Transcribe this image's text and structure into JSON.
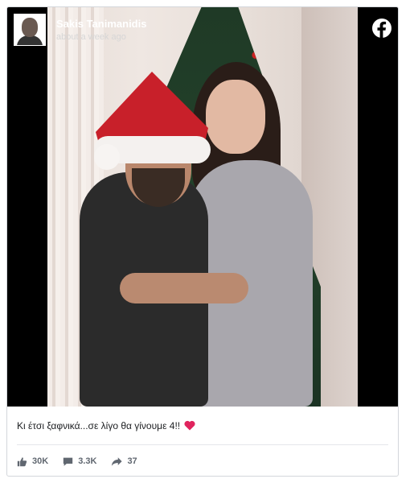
{
  "post": {
    "author": "Sakis Tanimanidis",
    "timestamp": "about a week ago",
    "caption": "Κι έτσι ξαφνικά...σε λίγο θα γίνουμε 4!!",
    "caption_emoji": "heart-icon"
  },
  "stats": {
    "likes": "30K",
    "comments": "3.3K",
    "shares": "37"
  },
  "icons": {
    "brand": "facebook-icon",
    "like": "thumbs-up-icon",
    "comment": "comment-icon",
    "share": "share-arrow-icon"
  },
  "colors": {
    "facebook": "#ffffff",
    "heart": "#e0245e",
    "text": "#1c1e21",
    "muted": "#606770"
  }
}
